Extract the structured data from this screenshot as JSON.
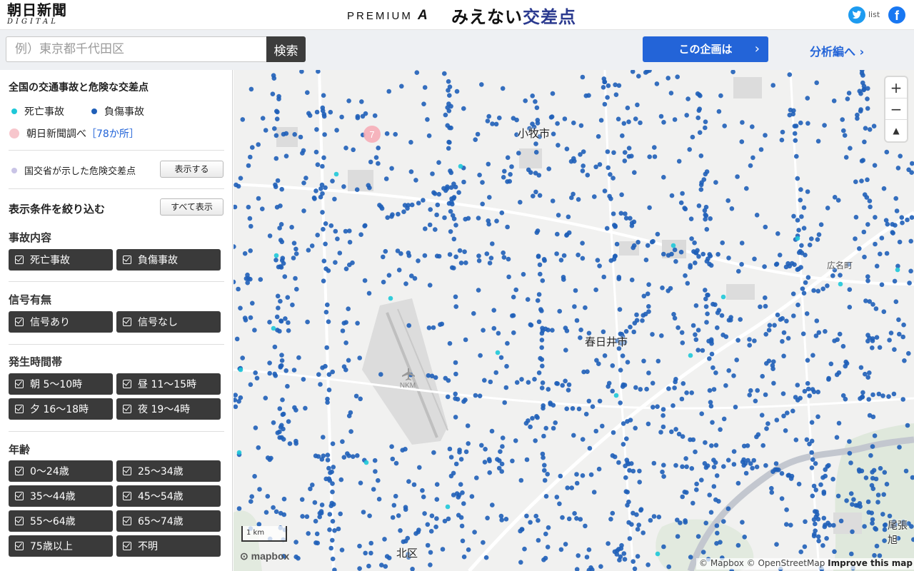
{
  "header": {
    "logo_line1": "朝日新聞",
    "logo_line2": "DIGITAL",
    "brand_premium": "PREMIUM",
    "brand_a": "A",
    "series_title_a": "みえない",
    "series_title_b": "交差点",
    "list_label": "list",
    "facebook_glyph": "f",
    "icons": [
      "twitter-icon",
      "facebook-icon"
    ]
  },
  "search": {
    "placeholder": "例）東京都千代田区",
    "value": "",
    "button_label": "検索"
  },
  "nav": {
    "about_label": "この企画は",
    "about_chevron": "›",
    "analysis_label": "分析編へ ›"
  },
  "sidebar": {
    "title": "全国の交通事故と危険な交差点",
    "legend": {
      "fatal": "死亡事故",
      "injury": "負傷事故",
      "asahi": "朝日新聞調べ",
      "asahi_count": "［78か所］",
      "mlit": "国交省が示した危険交差点",
      "mlit_button": "表示する"
    },
    "filter_title": "表示条件を絞り込む",
    "show_all_button": "すべて表示",
    "groups": [
      {
        "title": "事故内容",
        "options": [
          "死亡事故",
          "負傷事故"
        ]
      },
      {
        "title": "信号有無",
        "options": [
          "信号あり",
          "信号なし"
        ]
      },
      {
        "title": "発生時間帯",
        "options": [
          "朝 5〜10時",
          "昼 11〜15時",
          "夕 16〜18時",
          "夜 19〜4時"
        ]
      },
      {
        "title": "年齢",
        "options": [
          "0〜24歳",
          "25〜34歳",
          "35〜44歳",
          "45〜54歳",
          "55〜64歳",
          "65〜74歳",
          "75歳以上",
          "不明"
        ]
      }
    ],
    "colors": {
      "fatal": "#1ec8d8",
      "injury": "#1f5fb8",
      "asahi": "#f7c6cc",
      "mlit": "#c9c4e6"
    }
  },
  "map": {
    "labels": {
      "komaki": "小牧市",
      "kasugai": "春日井市",
      "hiro": "広名町",
      "kita": "北区",
      "owari": "尾張旭",
      "airport": "NKM",
      "cluster": "7"
    },
    "zoom_in": "+",
    "zoom_out": "−",
    "compass": "▲",
    "scale": "1 km",
    "mapbox": "mapbox",
    "attribution": {
      "mapbox": "© Mapbox",
      "osm": "© OpenStreetMap",
      "improve": "Improve this map"
    }
  }
}
